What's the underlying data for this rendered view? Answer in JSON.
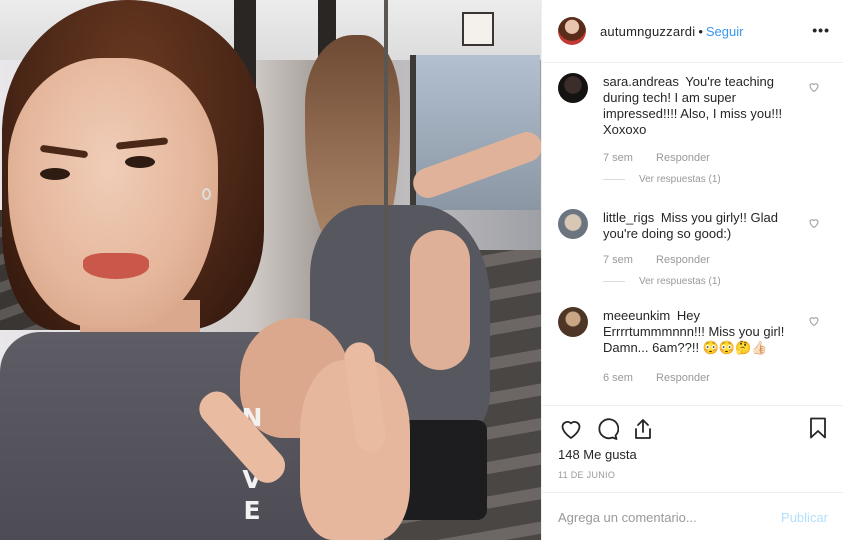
{
  "post": {
    "tank_text": [
      "N",
      "E",
      "V",
      "E"
    ]
  },
  "header": {
    "username": "autumnguzzardi",
    "separator": "•",
    "follow_label": "Seguir",
    "more_label": "•••"
  },
  "comments": [
    {
      "username": "sara.andreas",
      "text": "You're teaching during tech! I am super impressed!!!! Also, I miss you!!! Xoxoxo",
      "time": "7 sem",
      "reply_label": "Responder",
      "view_replies": "Ver respuestas (1)"
    },
    {
      "username": "little_rigs",
      "text": "Miss you girly!! Glad you're doing so good:)",
      "time": "7 sem",
      "reply_label": "Responder",
      "view_replies": "Ver respuestas (1)"
    },
    {
      "username": "meeeunkim",
      "text": "Hey Errrrtummmnnn!!! Miss you girl! Damn... 6am??!! 😳😳🤔👍🏻",
      "time": "6 sem",
      "reply_label": "Responder"
    }
  ],
  "actions": {
    "likes": "148 Me gusta",
    "date": "11 DE JUNIO"
  },
  "add_comment": {
    "placeholder": "Agrega un comentario...",
    "post_label": "Publicar"
  },
  "colors": {
    "link": "#3897f0",
    "post_disabled": "#b2dffc",
    "muted_text": "#999999"
  }
}
